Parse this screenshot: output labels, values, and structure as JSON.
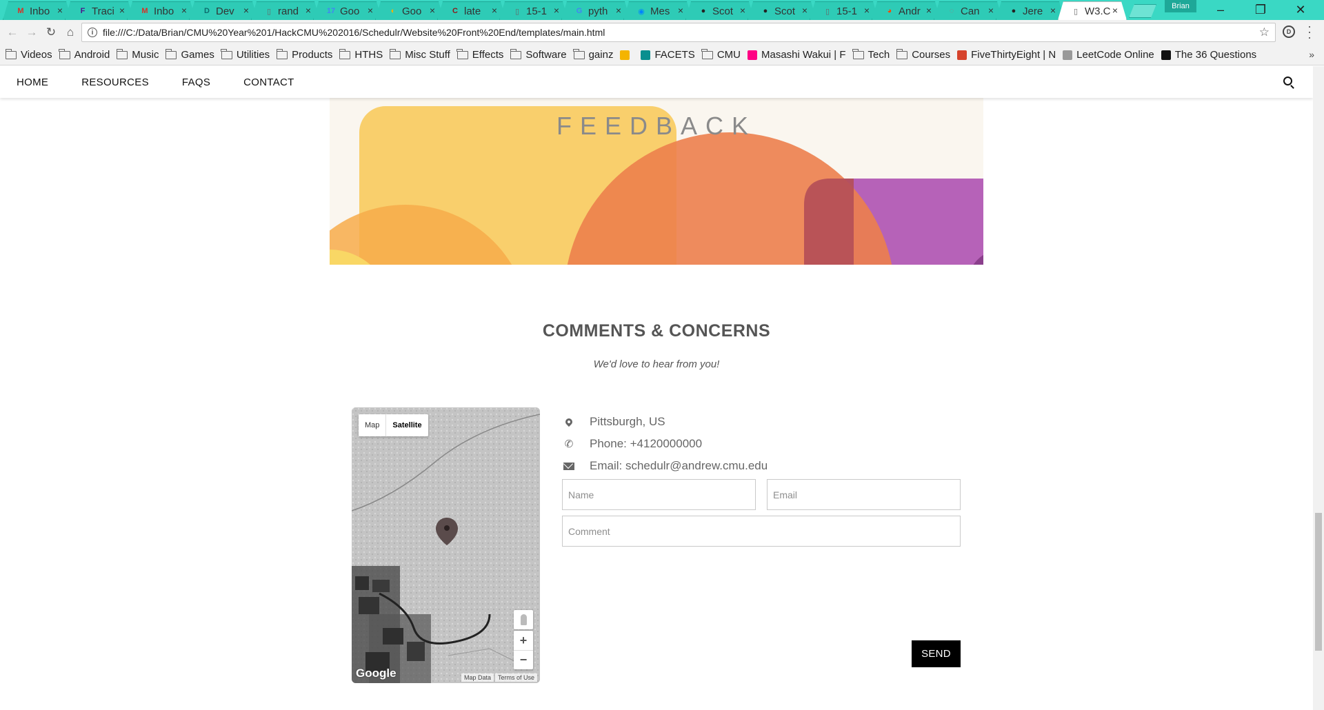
{
  "browser": {
    "tabs": [
      {
        "label": "Inbo",
        "icon": "gmail-icon",
        "color": "#d93025",
        "glyph": "M"
      },
      {
        "label": "Traci",
        "icon": "fedex-icon",
        "color": "#4d148c",
        "glyph": "F"
      },
      {
        "label": "Inbo",
        "icon": "gmail-icon",
        "color": "#d93025",
        "glyph": "M"
      },
      {
        "label": "Dev",
        "icon": "dev-icon",
        "color": "#0d6e6e",
        "glyph": "D"
      },
      {
        "label": "rand",
        "icon": "doc-icon",
        "color": "#666666",
        "glyph": "▯"
      },
      {
        "label": "Goo",
        "icon": "calendar-icon",
        "color": "#4285f4",
        "glyph": "17"
      },
      {
        "label": "Goo",
        "icon": "keep-icon",
        "color": "#f4b400",
        "glyph": "◐"
      },
      {
        "label": "late",
        "icon": "latex-icon",
        "color": "#8b1a1a",
        "glyph": "C"
      },
      {
        "label": "15-1",
        "icon": "doc-icon",
        "color": "#666666",
        "glyph": "▯"
      },
      {
        "label": "pyth",
        "icon": "google-icon",
        "color": "#4285f4",
        "glyph": "G"
      },
      {
        "label": "Mes",
        "icon": "messenger-icon",
        "color": "#0084ff",
        "glyph": "◉"
      },
      {
        "label": "Scot",
        "icon": "github-icon",
        "color": "#222222",
        "glyph": "●"
      },
      {
        "label": "Scot",
        "icon": "github-icon",
        "color": "#222222",
        "glyph": "●"
      },
      {
        "label": "15-1",
        "icon": "doc-icon",
        "color": "#666666",
        "glyph": "▯"
      },
      {
        "label": "Andr",
        "icon": "reddit-icon",
        "color": "#ff4500",
        "glyph": "◕"
      },
      {
        "label": "Can",
        "icon": "loading-icon",
        "color": "#888888",
        "glyph": "◌"
      },
      {
        "label": "Jere",
        "icon": "github-icon",
        "color": "#222222",
        "glyph": "●"
      },
      {
        "label": "W3.C",
        "icon": "doc-icon",
        "color": "#666666",
        "glyph": "▯",
        "active": true
      }
    ],
    "profile": "Brian",
    "url": "file:///C:/Data/Brian/CMU%20Year%201/HackCMU%202016/Schedulr/Website%20Front%20End/templates/main.html",
    "bookmarks": [
      {
        "label": "Videos",
        "type": "folder"
      },
      {
        "label": "Android",
        "type": "folder"
      },
      {
        "label": "Music",
        "type": "folder"
      },
      {
        "label": "Games",
        "type": "folder"
      },
      {
        "label": "Utilities",
        "type": "folder"
      },
      {
        "label": "Products",
        "type": "folder"
      },
      {
        "label": "HTHS",
        "type": "folder"
      },
      {
        "label": "Misc Stuff",
        "type": "folder"
      },
      {
        "label": "Effects",
        "type": "folder"
      },
      {
        "label": "Software",
        "type": "folder"
      },
      {
        "label": "gainz",
        "type": "folder"
      },
      {
        "label": "",
        "type": "site",
        "icon": "keep-icon",
        "color": "#f4b400"
      },
      {
        "label": "FACETS",
        "type": "site",
        "icon": "facets-icon",
        "color": "#0a8f8f"
      },
      {
        "label": "CMU",
        "type": "folder"
      },
      {
        "label": "Masashi Wakui | F",
        "type": "site",
        "icon": "flickr-icon",
        "color": "#ff0084"
      },
      {
        "label": "Tech",
        "type": "folder"
      },
      {
        "label": "Courses",
        "type": "folder"
      },
      {
        "label": "FiveThirtyEight | N",
        "type": "site",
        "icon": "fivethirtyeight-icon",
        "color": "#d6432c"
      },
      {
        "label": "LeetCode Online",
        "type": "site",
        "icon": "leetcode-icon",
        "color": "#999999"
      },
      {
        "label": "The 36 Questions",
        "type": "site",
        "icon": "nytimes-icon",
        "color": "#111111"
      }
    ]
  },
  "site": {
    "nav": [
      "HOME",
      "RESOURCES",
      "FAQS",
      "CONTACT"
    ],
    "banner_title": "FEEDBACK",
    "section_title": "COMMENTS & CONCERNS",
    "section_subtitle": "We'd love to hear from you!",
    "map": {
      "toggle_map": "Map",
      "toggle_satellite": "Satellite",
      "zoom_in": "+",
      "zoom_out": "−",
      "logo": "Google",
      "map_data": "Map Data",
      "terms": "Terms of Use"
    },
    "contact": {
      "location": "Pittsburgh, US",
      "phone": "Phone: +4120000000",
      "email": "Email: schedulr@andrew.cmu.edu"
    },
    "form": {
      "name_placeholder": "Name",
      "email_placeholder": "Email",
      "comment_placeholder": "Comment",
      "send_label": "SEND"
    }
  },
  "colors": {
    "tabbar": "#3ad8c4",
    "banner_yellow": "#f9cf6c",
    "banner_orange": "#ec7f4d",
    "banner_purple": "#b662b8",
    "send_bg": "#000000"
  }
}
